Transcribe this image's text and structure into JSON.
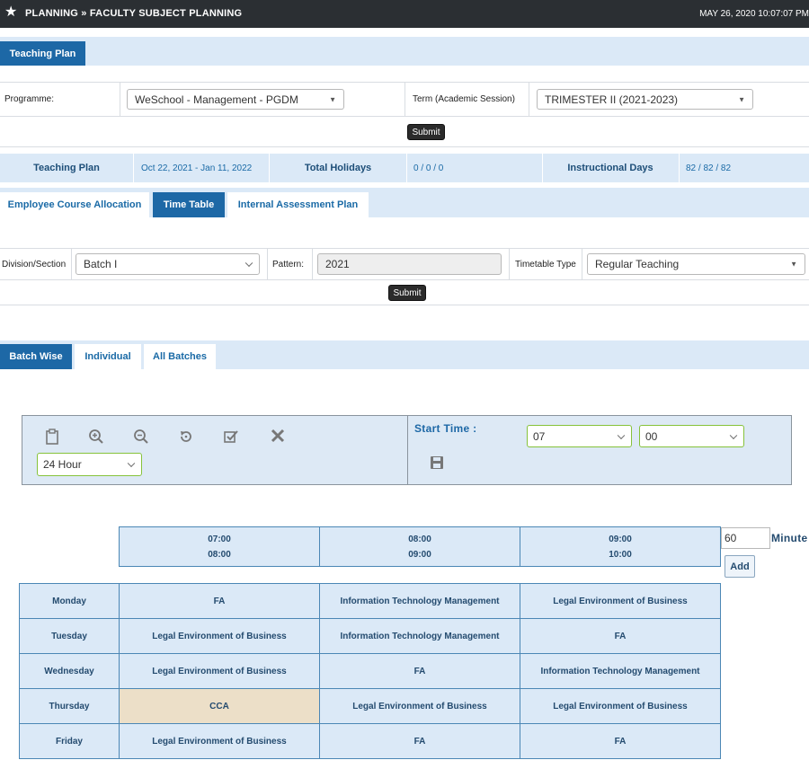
{
  "header": {
    "breadcrumb": "PLANNING » FACULTY SUBJECT PLANNING",
    "datetime": "MAY 26, 2020  10:07:07 PM"
  },
  "teaching_plan_tab": "Teaching Plan",
  "filters": {
    "programme_label": "Programme:",
    "programme_value": "WeSchool - Management - PGDM",
    "term_label": "Term (Academic Session)",
    "term_value": "TRIMESTER II (2021-2023)",
    "submit_label": "Submit"
  },
  "summary": {
    "teaching_plan_label": "Teaching Plan",
    "teaching_plan_value": "Oct 22, 2021 - Jan 11, 2022",
    "holidays_label": "Total Holidays",
    "holidays_value": "0 / 0 / 0",
    "instr_label": "Instructional Days",
    "instr_value": "82 / 82 / 82"
  },
  "subtabs": [
    "Employee Course Allocation",
    "Time Table",
    "Internal Assessment Plan"
  ],
  "tt_filters": {
    "division_label": "Division/Section",
    "division_value": "Batch I",
    "pattern_label": "Pattern:",
    "pattern_value": "2021",
    "type_label": "Timetable Type",
    "type_value": "Regular Teaching",
    "submit_label": "Submit"
  },
  "view_tabs": [
    "Batch Wise",
    "Individual",
    "All Batches"
  ],
  "toolbar": {
    "hour_format": "24 Hour",
    "start_time_label": "Start Time :",
    "start_hour": "07",
    "start_minute": "00"
  },
  "timetable": {
    "slots": [
      {
        "start": "07:00",
        "end": "08:00"
      },
      {
        "start": "08:00",
        "end": "09:00"
      },
      {
        "start": "09:00",
        "end": "10:00"
      }
    ],
    "minutes_value": "60",
    "minutes_label": "Minute",
    "add_label": "Add",
    "rows": [
      {
        "day": "Monday",
        "cells": [
          "FA",
          "Information Technology Management",
          "Legal Environment of Business"
        ]
      },
      {
        "day": "Tuesday",
        "cells": [
          "Legal Environment of Business",
          "Information Technology Management",
          "FA"
        ]
      },
      {
        "day": "Wednesday",
        "cells": [
          "Legal Environment of Business",
          "FA",
          "Information Technology Management"
        ]
      },
      {
        "day": "Thursday",
        "cells": [
          "CCA",
          "Legal Environment of Business",
          "Legal Environment of Business"
        ]
      },
      {
        "day": "Friday",
        "cells": [
          "Legal Environment of Business",
          "FA",
          "FA"
        ]
      }
    ]
  },
  "colors": {
    "accent": "#1d68a6",
    "strip": "#dbe9f7",
    "topbar": "#2b2f33",
    "cca_highlight": "#ecdfc8"
  }
}
